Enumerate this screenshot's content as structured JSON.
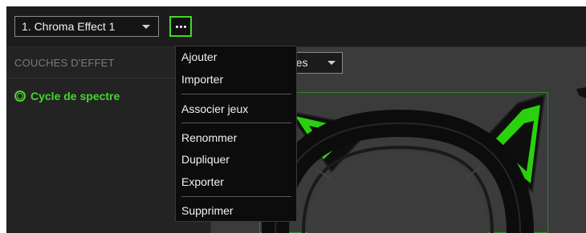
{
  "header": {
    "effect_select": "1. Chroma Effect 1",
    "more_button_icon": "more-dots-icon"
  },
  "sidebar": {
    "title": "COUCHES D'EFFET",
    "layers": [
      {
        "label": "Cycle de spectre",
        "icon": "spectrum-cycle-icon"
      }
    ]
  },
  "canvas": {
    "quick_select_partial": "pides"
  },
  "menu": {
    "items": [
      {
        "label": "Ajouter"
      },
      {
        "label": "Importer"
      },
      {
        "label": "Associer jeux"
      },
      {
        "label": "Renommer"
      },
      {
        "label": "Dupliquer"
      },
      {
        "label": "Exporter"
      },
      {
        "label": "Supprimer"
      }
    ]
  },
  "colors": {
    "accent": "#44d62c",
    "background": "#1f1f1f",
    "menu_background": "#0c0c0c"
  }
}
